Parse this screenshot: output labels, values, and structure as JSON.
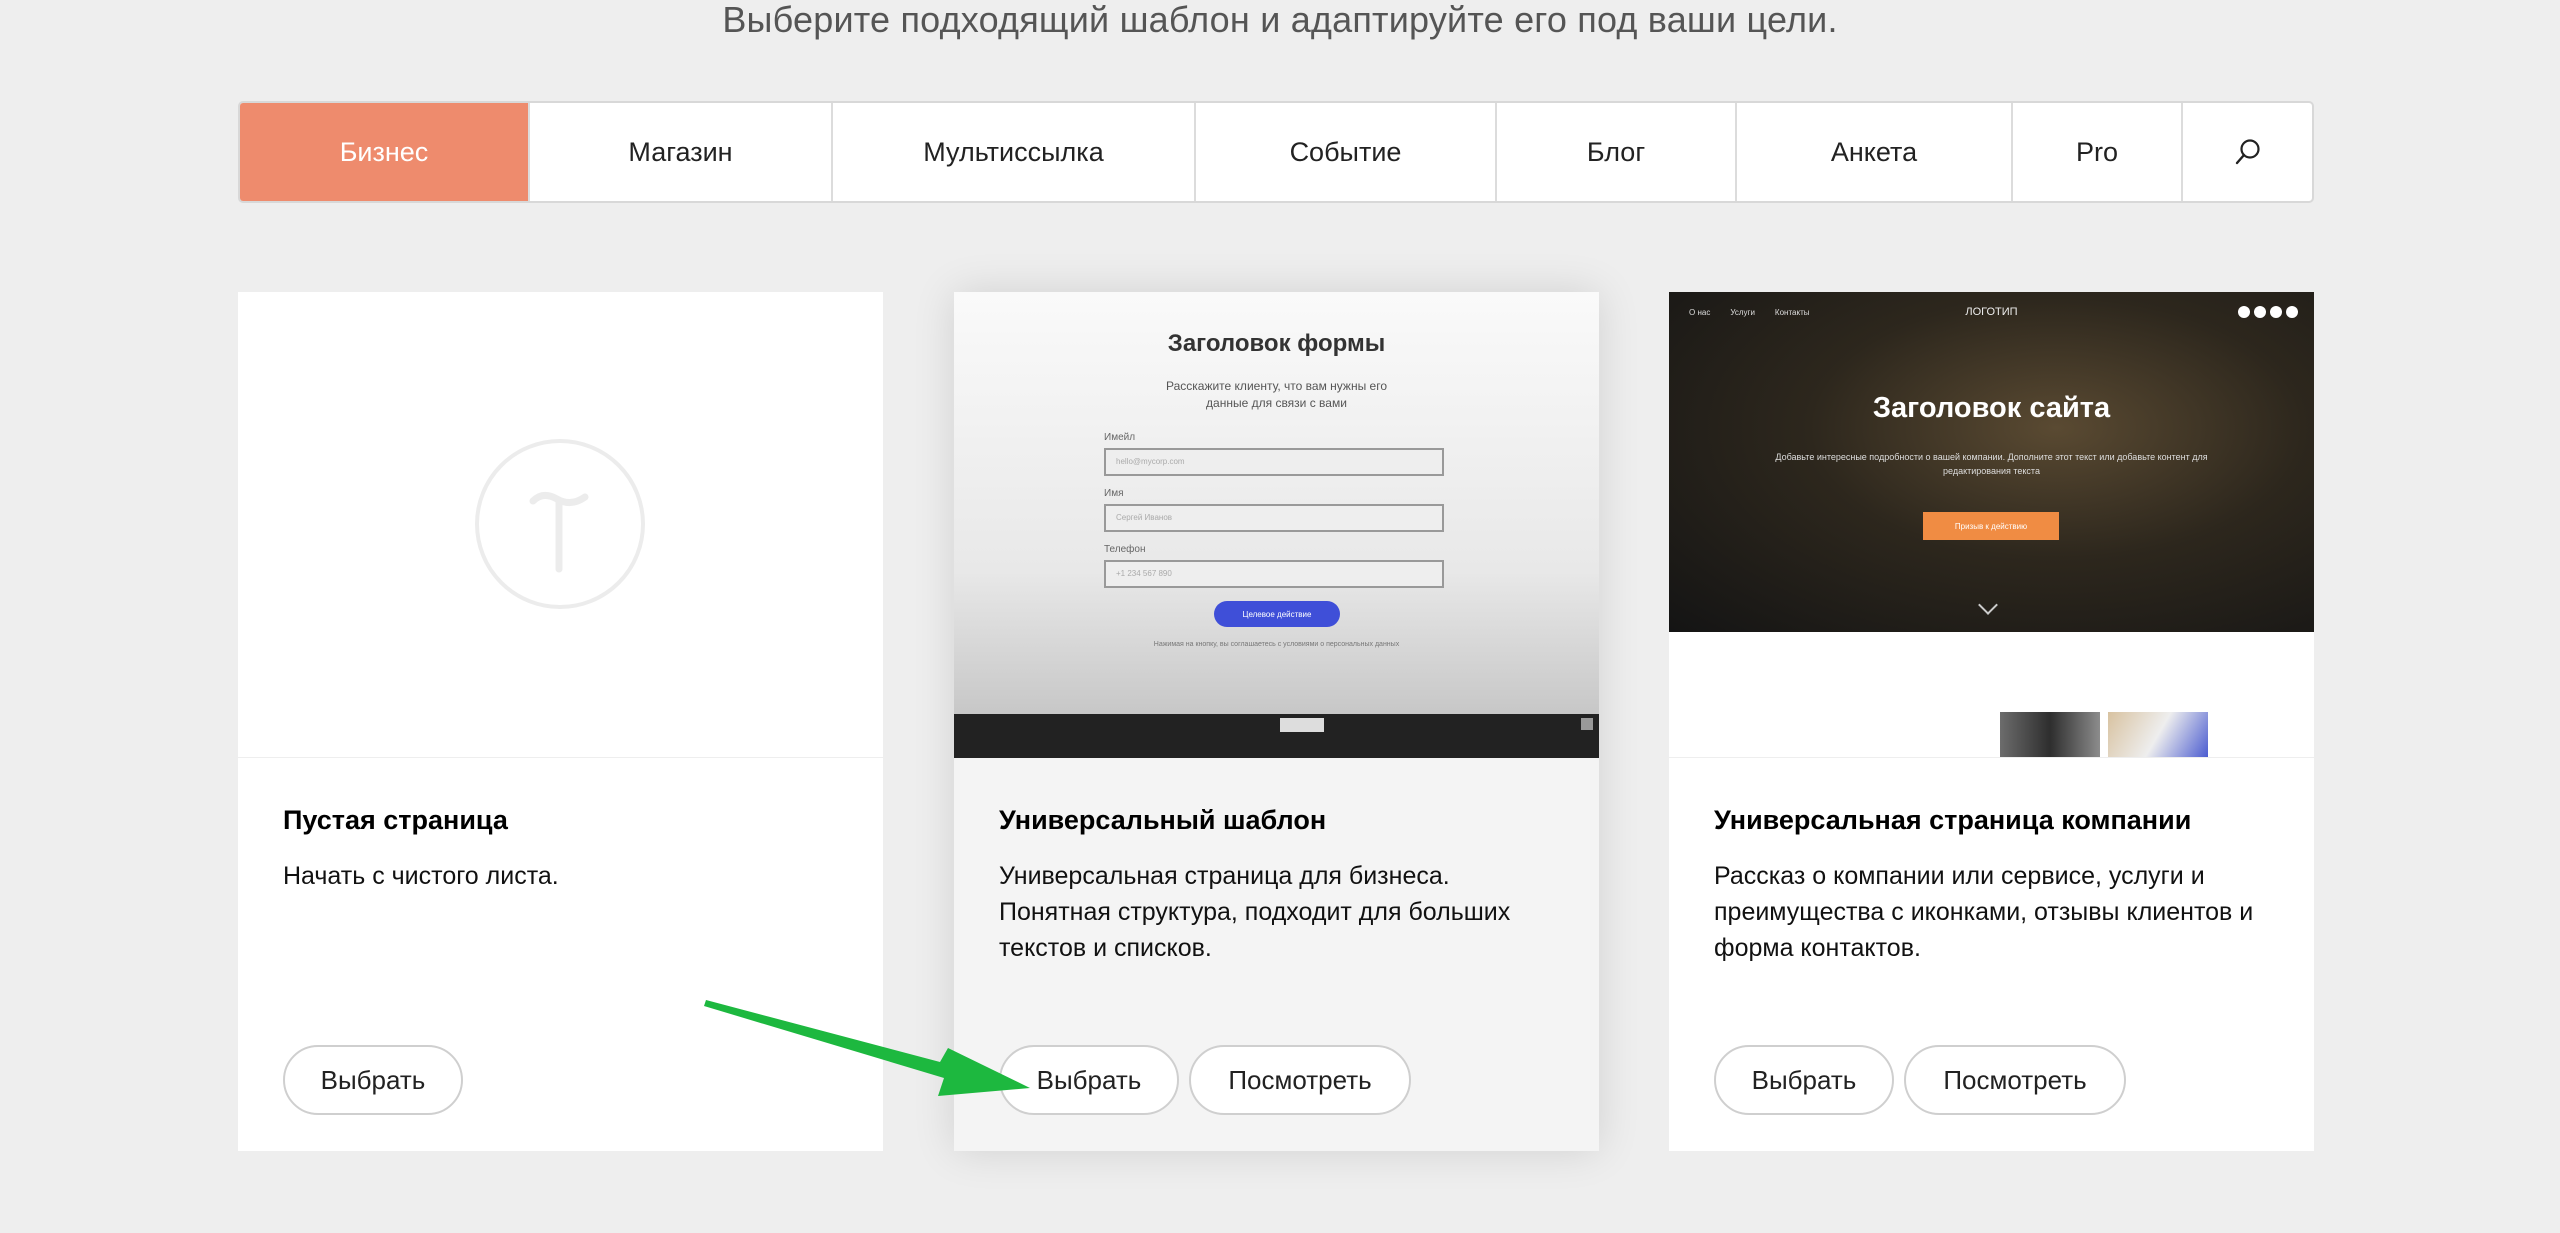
{
  "subtitle": "Выберите подходящий шаблон и адаптируйте его под ваши цели.",
  "tabs": [
    {
      "label": "Бизнес",
      "active": true
    },
    {
      "label": "Магазин"
    },
    {
      "label": "Мультиссылка"
    },
    {
      "label": "Событие"
    },
    {
      "label": "Блог"
    },
    {
      "label": "Анкета"
    },
    {
      "label": "Pro"
    }
  ],
  "search_icon": "search-icon",
  "accent_color": "#ee8b6d",
  "cards": [
    {
      "title": "Пустая страница",
      "description": "Начать с чистого листа.",
      "select_label": "Выбрать"
    },
    {
      "title": "Универсальный шаблон",
      "description": "Универсальная страница для бизнеса. Понятная структура, подходит для больших текстов и списков.",
      "select_label": "Выбрать",
      "view_label": "Посмотреть",
      "preview": {
        "form_title": "Заголовок формы",
        "form_subtitle": "Расскажите клиенту, что вам нужны его данные для связи с вами",
        "fields": [
          {
            "label": "Имейл",
            "placeholder": "hello@mycorp.com"
          },
          {
            "label": "Имя",
            "placeholder": "Сергей Иванов"
          },
          {
            "label": "Телефон",
            "placeholder": "+1 234 567 890"
          }
        ],
        "button": "Целевое действие",
        "note": "Нажимая на кнопку, вы соглашаетесь с условиями о персональных данных"
      }
    },
    {
      "title": "Универсальная страница компании",
      "description": "Рассказ о компании или сервисе, услуги и преимущества с иконками, отзывы клиентов и форма контактов.",
      "select_label": "Выбрать",
      "view_label": "Посмотреть",
      "preview": {
        "nav": [
          "О нас",
          "Услуги",
          "Контакты"
        ],
        "brand": "ЛОГОТИП",
        "title": "Заголовок сайта",
        "subtitle": "Добавьте интересные подробности о вашей компании. Дополните этот текст или добавьте контент для редактирования текста",
        "button": "Призыв к действию"
      }
    }
  ]
}
